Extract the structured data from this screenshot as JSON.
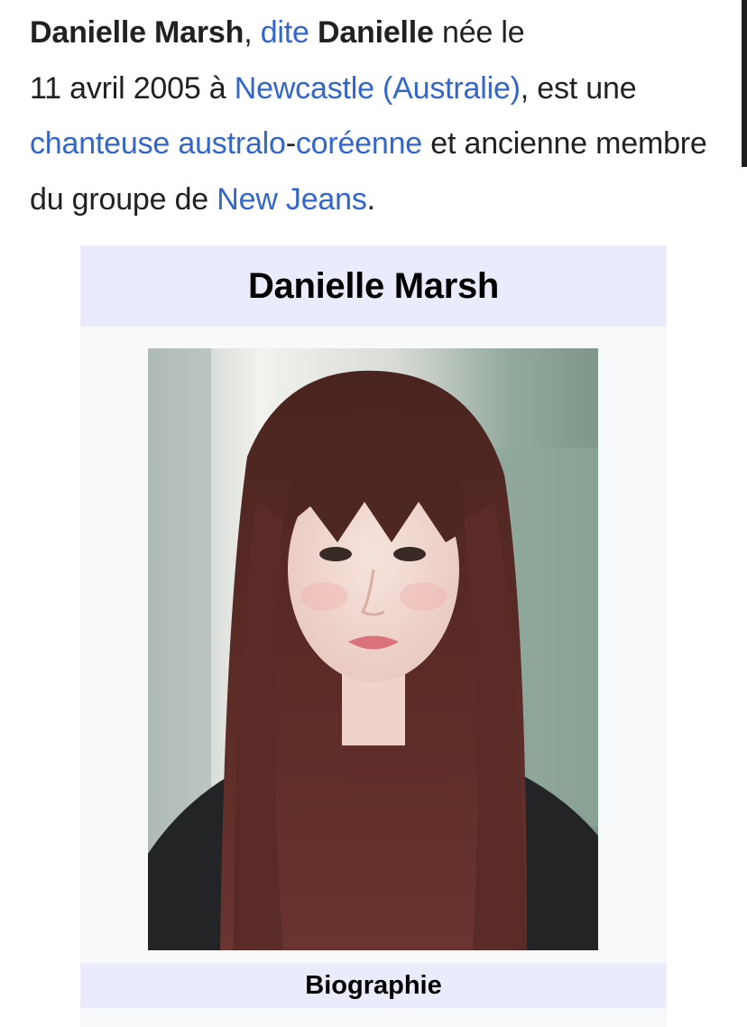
{
  "intro": {
    "subject_name": "Danielle Marsh",
    "comma": ",",
    "link_dite": "dite",
    "stage_name": "Danielle",
    "text_nee_le": " née le",
    "birth_date": "11 avril 2005 à ",
    "link_birthplace": "Newcastle (Australie)",
    "text_est_une": ", est une ",
    "link_chanteuse": "chanteuse",
    "link_australo": "australo",
    "hyphen": "-",
    "link_coreenne": "coréenne",
    "text_et_ancienne": " et ancienne membre du groupe de ",
    "link_group": "New Jeans",
    "period": "."
  },
  "infobox": {
    "title": "Danielle Marsh",
    "section_biographie": "Biographie"
  }
}
